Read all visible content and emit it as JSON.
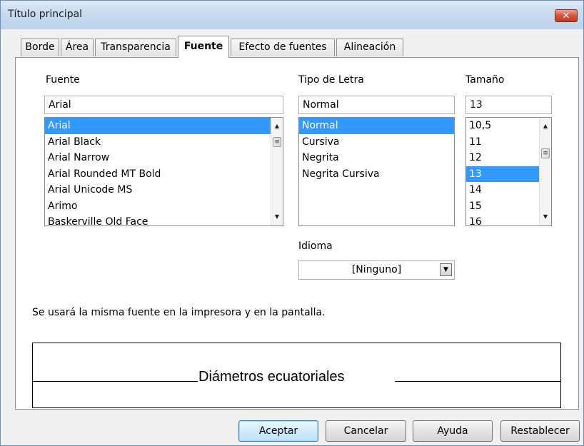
{
  "window": {
    "title": "Título principal",
    "close_symbol": "✕"
  },
  "tabs": [
    {
      "label": "Borde"
    },
    {
      "label": "Área"
    },
    {
      "label": "Transparencia"
    },
    {
      "label": "Fuente",
      "active": true
    },
    {
      "label": "Efecto de fuentes"
    },
    {
      "label": "Alineación"
    }
  ],
  "font": {
    "label": "Fuente",
    "value": "Arial",
    "items": [
      "Arial",
      "Arial Black",
      "Arial Narrow",
      "Arial Rounded MT Bold",
      "Arial Unicode MS",
      "Arimo",
      "Baskerville Old Face"
    ],
    "selected": "Arial"
  },
  "style": {
    "label": "Tipo de Letra",
    "value": "Normal",
    "items": [
      "Normal",
      "Cursiva",
      "Negrita",
      "Negrita Cursiva"
    ],
    "selected": "Normal"
  },
  "size": {
    "label": "Tamaño",
    "value": "13",
    "items": [
      "10,5",
      "11",
      "12",
      "13",
      "14",
      "15",
      "16"
    ],
    "selected": "13"
  },
  "language": {
    "label": "Idioma",
    "value": "[Ninguno]"
  },
  "info_text": "Se usará la misma fuente en la impresora y en la pantalla.",
  "preview": {
    "text": "Diámetros ecuatoriales"
  },
  "buttons": {
    "ok": "Aceptar",
    "cancel": "Cancelar",
    "help": "Ayuda",
    "reset": "Restablecer"
  },
  "colors": {
    "selection": "#3399ff",
    "close": "#c43b21",
    "titlebar": "#c5d8ee"
  }
}
